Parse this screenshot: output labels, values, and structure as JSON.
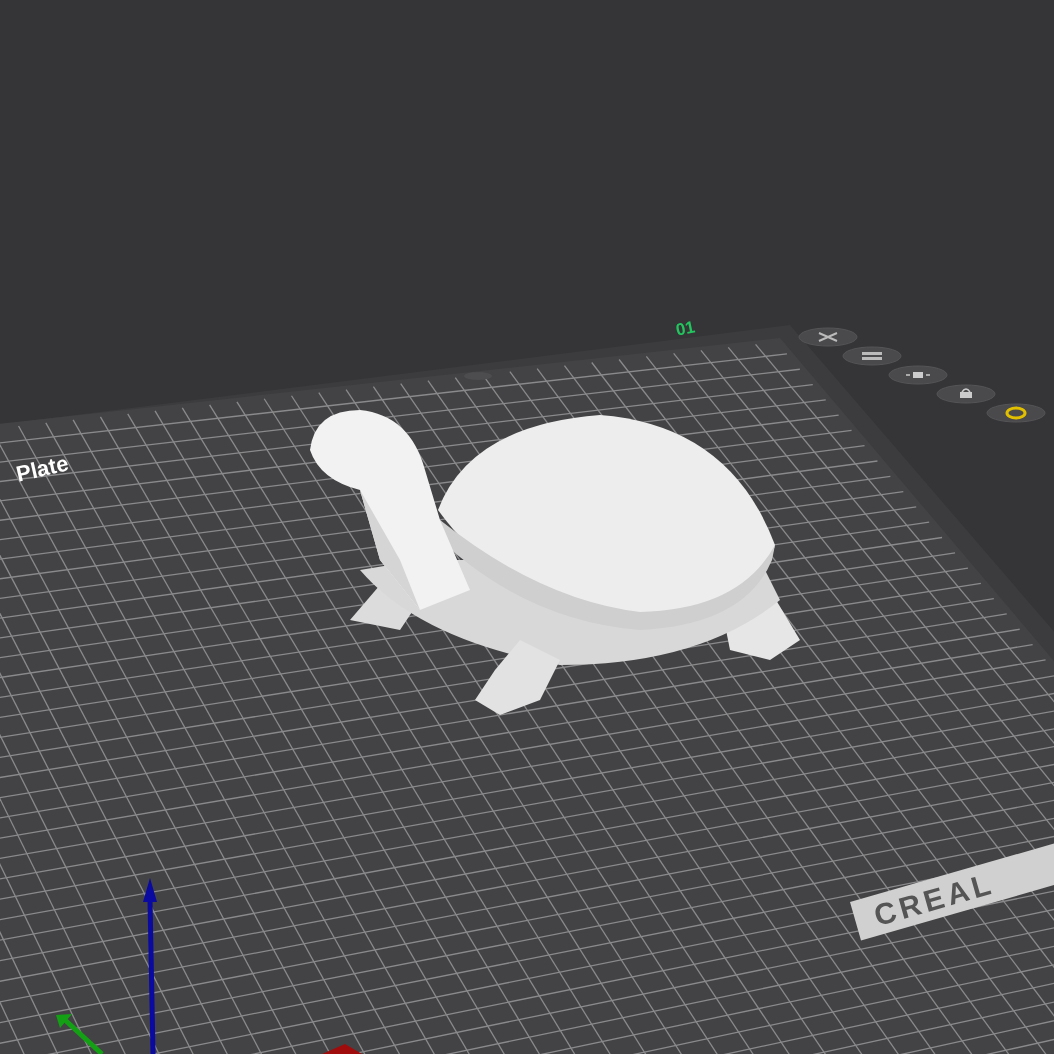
{
  "viewport": {
    "plate_number": "01",
    "plate_label": "Plate",
    "bed_logo": "CREAL"
  }
}
